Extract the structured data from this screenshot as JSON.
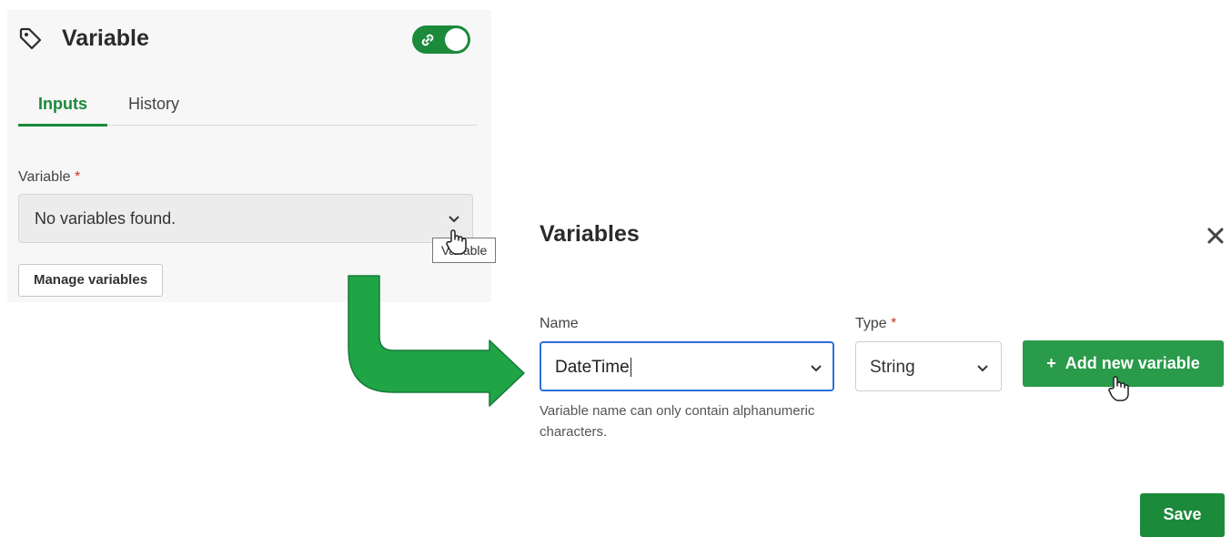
{
  "panel": {
    "title": "Variable",
    "title_icon": "tag-icon",
    "link_toggle": {
      "icon": "link-icon",
      "state": "on"
    },
    "tabs": [
      {
        "label": "Inputs",
        "active": true
      },
      {
        "label": "History",
        "active": false
      }
    ],
    "variable_field": {
      "label": "Variable",
      "required_mark": "*",
      "value": "No variables found."
    },
    "tooltip": "Variable",
    "manage_button": "Manage variables"
  },
  "dialog": {
    "title": "Variables",
    "name_field": {
      "label": "Name",
      "value": "DateTime"
    },
    "type_field": {
      "label": "Type",
      "required_mark": "*",
      "value": "String"
    },
    "add_button": {
      "plus": "+",
      "label": "Add new variable"
    },
    "helper_text": "Variable name can only contain alphanumeric characters.",
    "save_button": "Save"
  },
  "colors": {
    "accent_green": "#1b8a3a",
    "button_green": "#2a9a4b",
    "arrow_green": "#1fa545",
    "focus_blue": "#2f6ed8",
    "required_red": "#d0352c"
  }
}
